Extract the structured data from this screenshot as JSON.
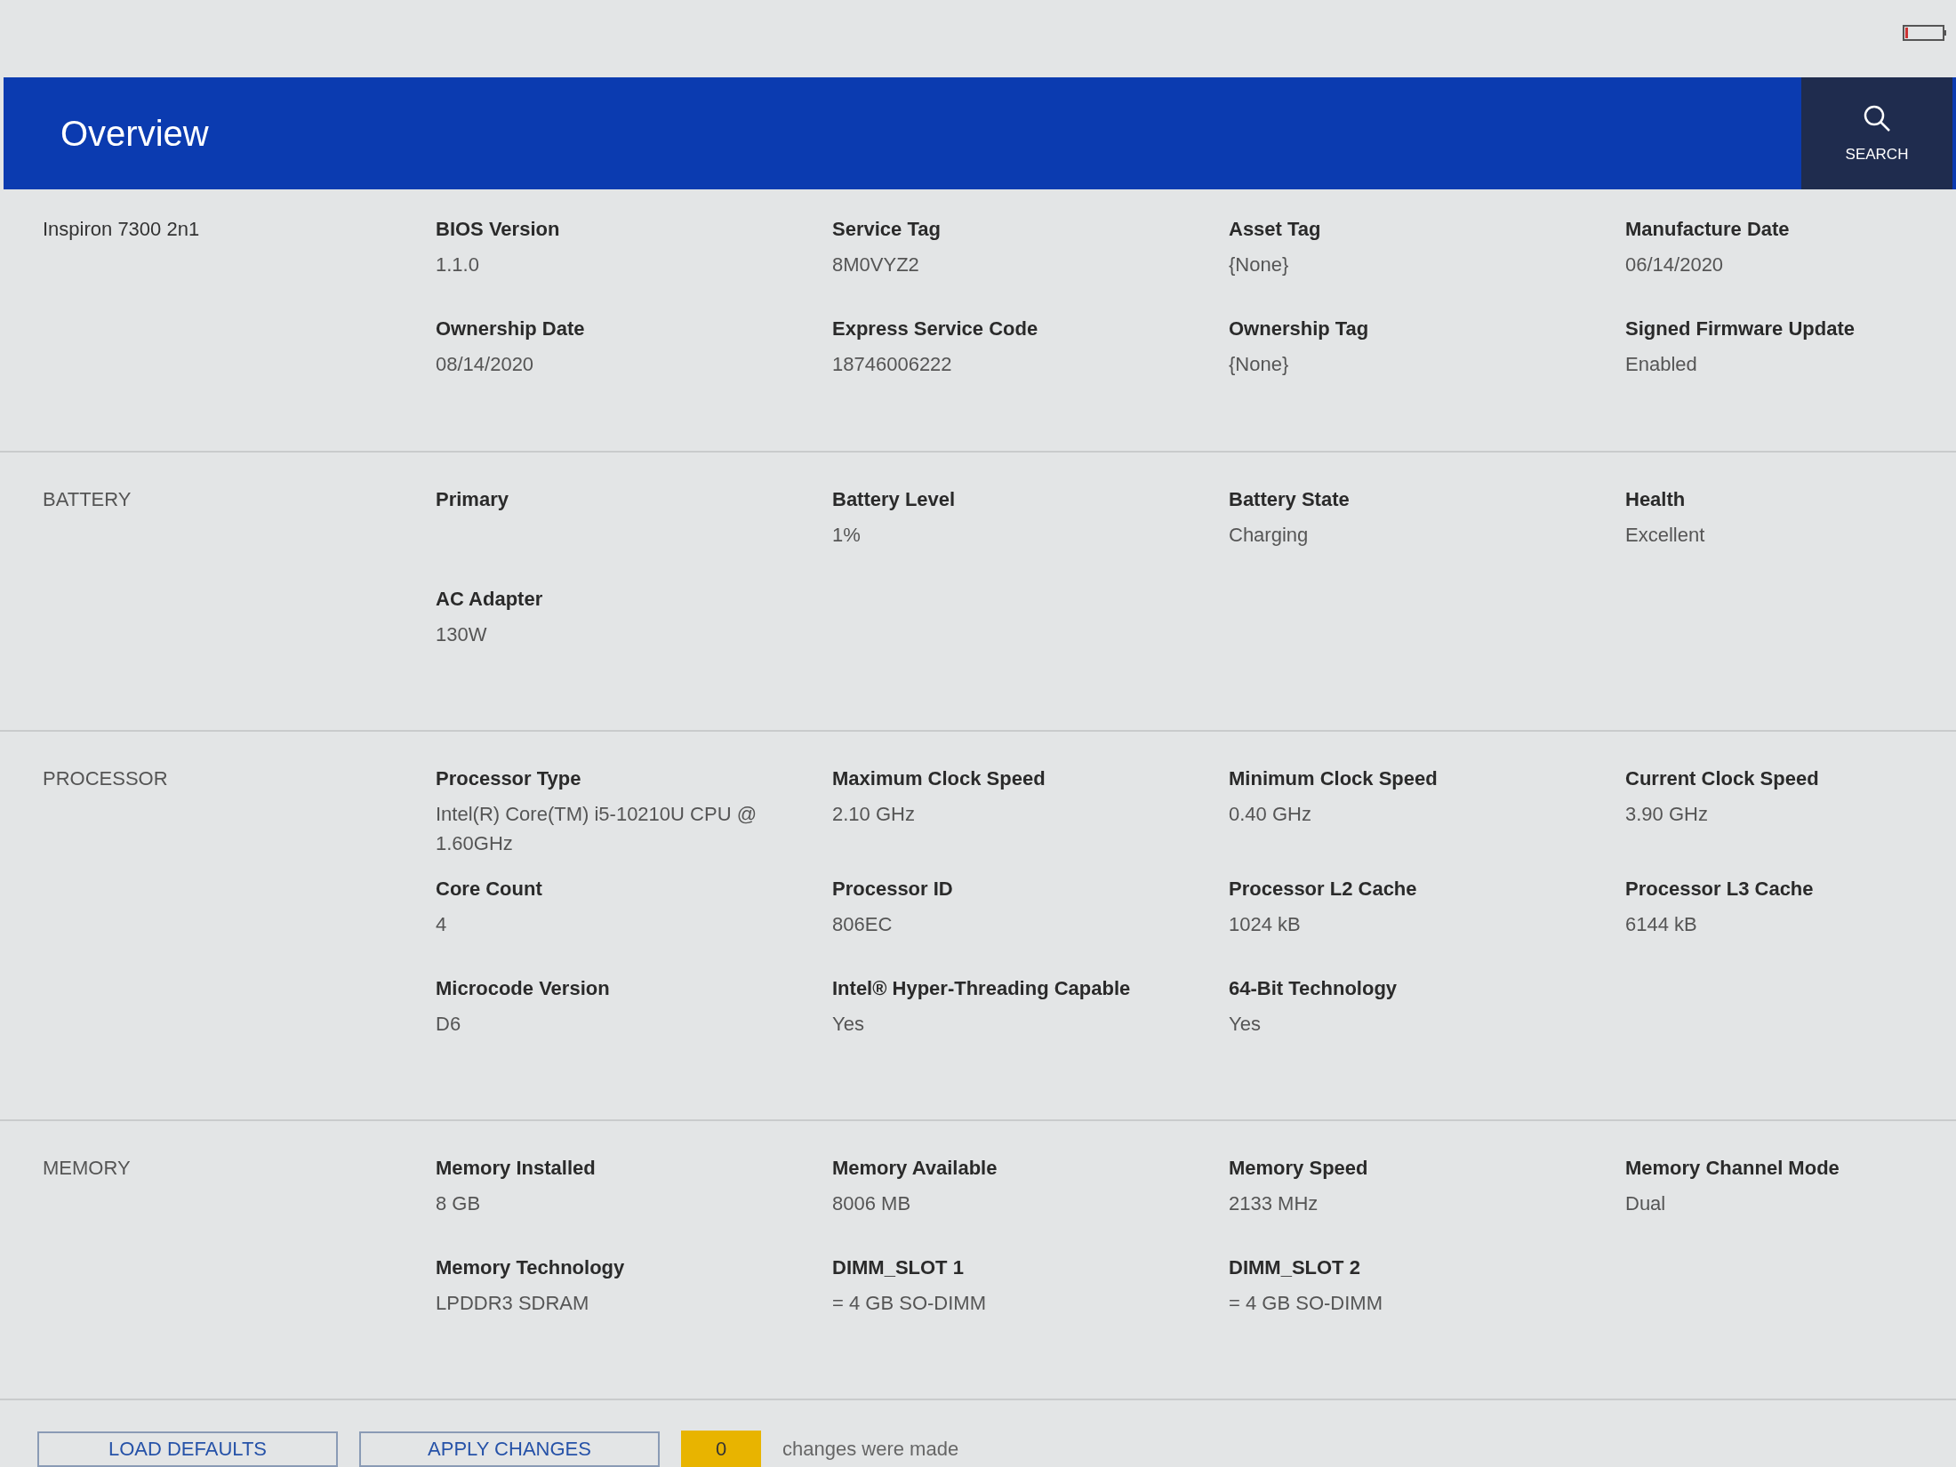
{
  "header": {
    "title": "Overview",
    "search_label": "SEARCH"
  },
  "sections": [
    {
      "label": "Inspiron 7300 2n1",
      "fields": [
        {
          "label": "BIOS Version",
          "value": "1.1.0"
        },
        {
          "label": "Service Tag",
          "value": "8M0VYZ2"
        },
        {
          "label": "Asset Tag",
          "value": "{None}"
        },
        {
          "label": "Manufacture Date",
          "value": "06/14/2020"
        },
        {
          "label": "Ownership Date",
          "value": "08/14/2020"
        },
        {
          "label": "Express Service Code",
          "value": "18746006222"
        },
        {
          "label": "Ownership Tag",
          "value": "{None}"
        },
        {
          "label": "Signed Firmware Update",
          "value": "Enabled"
        }
      ]
    },
    {
      "label": "BATTERY",
      "fields": [
        {
          "label": "Primary"
        },
        {
          "label": "Battery Level",
          "value": "1%"
        },
        {
          "label": "Battery State",
          "value": "Charging"
        },
        {
          "label": "Health",
          "value": "Excellent"
        },
        {
          "label": "AC Adapter",
          "value": "130W"
        }
      ]
    },
    {
      "label": "PROCESSOR",
      "fields": [
        {
          "label": "Processor Type",
          "value": "Intel(R) Core(TM) i5-10210U CPU @ 1.60GHz"
        },
        {
          "label": "Maximum Clock Speed",
          "value": "2.10 GHz"
        },
        {
          "label": "Minimum Clock Speed",
          "value": "0.40 GHz"
        },
        {
          "label": "Current Clock Speed",
          "value": "3.90 GHz"
        },
        {
          "label": "Core Count",
          "value": "4"
        },
        {
          "label": "Processor ID",
          "value": "806EC"
        },
        {
          "label": "Processor L2 Cache",
          "value": "1024 kB"
        },
        {
          "label": "Processor L3 Cache",
          "value": "6144 kB"
        },
        {
          "label": "Microcode Version",
          "value": "D6"
        },
        {
          "label": "Intel® Hyper-Threading Capable",
          "value": "Yes"
        },
        {
          "label": "64-Bit Technology",
          "value": "Yes"
        }
      ]
    },
    {
      "label": "MEMORY",
      "fields": [
        {
          "label": "Memory Installed",
          "value": "8 GB"
        },
        {
          "label": "Memory Available",
          "value": "8006 MB"
        },
        {
          "label": "Memory Speed",
          "value": "2133 MHz"
        },
        {
          "label": "Memory Channel Mode",
          "value": "Dual"
        },
        {
          "label": "Memory Technology",
          "value": "LPDDR3 SDRAM"
        },
        {
          "label": "DIMM_SLOT 1",
          "value": "= 4 GB SO-DIMM"
        },
        {
          "label": "DIMM_SLOT 2",
          "value": "= 4 GB SO-DIMM"
        }
      ]
    }
  ],
  "footer": {
    "buttons": [
      "LOAD DEFAULTS",
      "APPLY CHANGES"
    ],
    "change_count": "0",
    "change_text": "changes were made"
  }
}
